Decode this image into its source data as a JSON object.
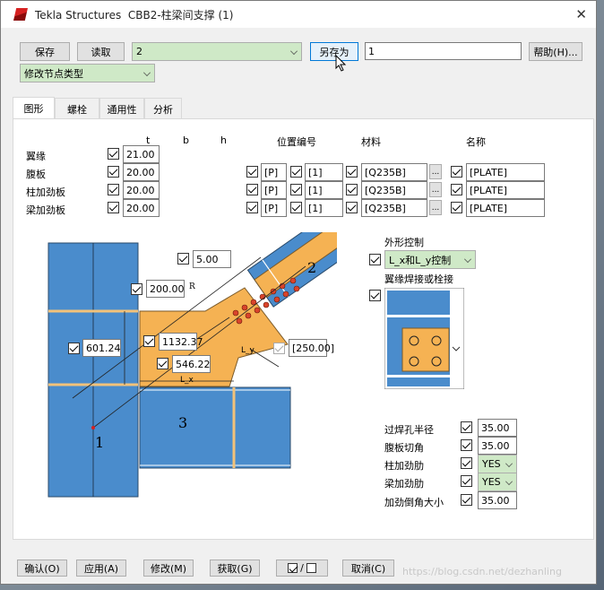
{
  "window": {
    "app": "Tekla Structures",
    "doc": "CBB2-柱梁间支撑 (1)"
  },
  "toolbar": {
    "save": "保存",
    "read": "读取",
    "preset_value": "2",
    "save_as": "另存为",
    "save_as_name": "1",
    "help": "帮助(H)...",
    "node_type": "修改节点类型"
  },
  "tabs": [
    "图形",
    "螺栓",
    "通用性",
    "分析"
  ],
  "grid": {
    "col_t": "t",
    "col_b": "b",
    "col_h": "h",
    "col_pos": "位置编号",
    "col_mat": "材料",
    "col_name": "名称",
    "rows": [
      {
        "label": "翼缘",
        "t": "21.00"
      },
      {
        "label": "腹板",
        "t": "20.00",
        "prefix": "[P]",
        "start": "[1]",
        "mat": "[Q235B]",
        "name": "[PLATE]"
      },
      {
        "label": "柱加劲板",
        "t": "20.00",
        "prefix": "[P]",
        "start": "[1]",
        "mat": "[Q235B]",
        "name": "[PLATE]"
      },
      {
        "label": "梁加劲板",
        "t": "20.00",
        "prefix": "[P]",
        "start": "[1]",
        "mat": "[Q235B]",
        "name": "[PLATE]"
      }
    ]
  },
  "diagram": {
    "v_offset": "5.00",
    "r_len": "200.00",
    "side": "601.24",
    "len1": "1132.37",
    "len2": "546.22",
    "len3": "[250.00]",
    "r_label": "R",
    "lx_label": "L_x",
    "ly_label": "L_y",
    "num1": "1",
    "num2": "2",
    "num3": "3"
  },
  "shape": {
    "label": "外形控制",
    "value": "L_x和L_y控制",
    "weld_label": "翼缘焊接或栓接"
  },
  "params": [
    {
      "label": "过焊孔半径",
      "value": "35.00"
    },
    {
      "label": "腹板切角",
      "value": "35.00"
    },
    {
      "label": "柱加劲肋",
      "value": "YES"
    },
    {
      "label": "梁加劲肋",
      "value": "YES"
    },
    {
      "label": "加劲倒角大小",
      "value": "35.00"
    }
  ],
  "bottom": {
    "ok": "确认(O)",
    "apply": "应用(A)",
    "modify": "修改(M)",
    "get": "获取(G)",
    "toggle": "/",
    "cancel": "取消(C)"
  },
  "watermark": "https://blog.csdn.net/dezhanling"
}
